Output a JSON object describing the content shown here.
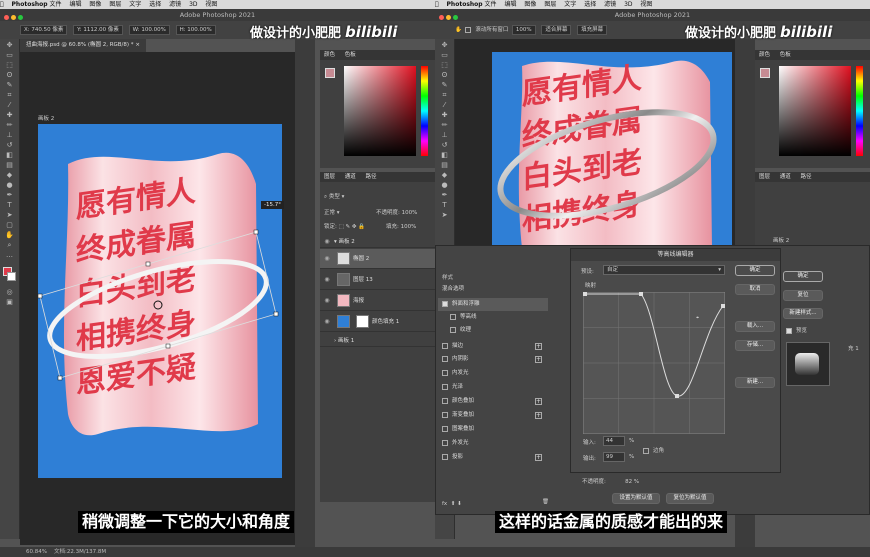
{
  "left": {
    "macbar": {
      "app": "Photoshop",
      "menus": [
        "文件",
        "编辑",
        "图像",
        "图层",
        "文字",
        "选择",
        "滤镜",
        "3D",
        "视图"
      ]
    },
    "title": "Adobe Photoshop 2021",
    "options": {
      "x": "X: 740.50 像素",
      "y": "Y: 1112.00 像素",
      "w": "W: 100.00%",
      "h": "H: 100.00%"
    },
    "doc_tab": "扭曲海报.psd @ 60.8% (椭圆 2, RGB/8) *",
    "artboard_label": "画板 2",
    "angle_readout": "-15.7°",
    "poster_lines": [
      "愿有情人",
      "终成眷属",
      "白头到老",
      "相携终身",
      "恩爱不疑"
    ],
    "color_panel": {
      "tabs": [
        "颜色",
        "色板"
      ]
    },
    "layers_panel": {
      "tabs": [
        "图层",
        "通道",
        "路径"
      ],
      "search": "类型",
      "blend": "正常",
      "opacity_label": "不透明度:",
      "opacity": "100%",
      "lock_label": "锁定:",
      "fill_label": "填充:",
      "fill": "100%",
      "layers": [
        {
          "name": "画板 2"
        },
        {
          "name": "椭圆 2"
        },
        {
          "name": "图层 13"
        },
        {
          "name": "海报"
        },
        {
          "name": "颜色填充 1"
        },
        {
          "name": "画板 1"
        }
      ]
    },
    "status": {
      "zoom": "60.84%",
      "doc": "文档:22.3M/137.8M"
    },
    "subtitle": "稍微调整一下它的大小和角度"
  },
  "right": {
    "options": {
      "scroll_all": "滚动所有窗口",
      "zoom": "100%",
      "fit": "适合屏幕",
      "fill": "填充屏幕"
    },
    "title": "Adobe Photoshop 2021",
    "color_panel": {
      "tabs": [
        "颜色",
        "色板"
      ]
    },
    "layers_panel": {
      "tabs": [
        "图层",
        "通道",
        "路径"
      ],
      "artboard": "画板 2",
      "fill_frag": "充 1"
    },
    "layer_style": {
      "items": [
        "样式",
        "混合选项",
        "斜面和浮雕",
        "等高线",
        "纹理",
        "描边",
        "内阴影",
        "内发光",
        "光泽",
        "颜色叠加",
        "渐变叠加",
        "图案叠加",
        "外发光",
        "投影"
      ],
      "fx": "fx",
      "bottom_opacity_label": "不透明度:",
      "bottom_opacity": "82",
      "bottom_opacity_unit": "%",
      "set_default": "设置为默认值",
      "reset_default": "复位为默认值",
      "ok": "确定",
      "reset": "复位",
      "new_style": "新建样式...",
      "preview": "预览"
    },
    "contour_editor": {
      "title": "等高线编辑器",
      "preset_label": "预设:",
      "preset": "自定",
      "mapping": "映射",
      "ok": "确定",
      "cancel": "取消",
      "load": "载入...",
      "save": "存储...",
      "new": "新建...",
      "input_label": "输入:",
      "input": "44",
      "output_label": "输出:",
      "output": "99",
      "unit": "%",
      "corner": "边角"
    },
    "subtitle": "这样的话金属的质感才能出的来"
  },
  "watermark": {
    "text": "做设计的小肥肥",
    "logo": "bilibili"
  },
  "colors": {
    "poster_bg": "#2f7fd6",
    "letter_red": "#e03a4a",
    "cloth_pink": "#f7c9cf",
    "ui_gray": "#535353"
  }
}
